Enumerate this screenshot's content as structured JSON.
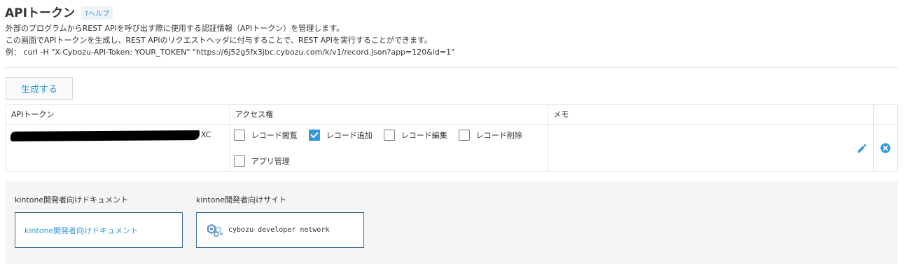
{
  "header": {
    "title": "APIトークン",
    "help_label": "?ヘルプ"
  },
  "description": {
    "line1": "外部のプログラムからREST APIを呼び出す際に使用する認証情報（APIトークン）を管理します。",
    "line2": "この画面でAPIトークンを生成し、REST APIのリクエストヘッダに付与することで、REST APIを実行することができます。",
    "line3": "例：  curl -H \"X-Cybozu-API-Token: YOUR_TOKEN\" \"https://6j52g5fx3jbc.cybozu.com/k/v1/record.json?app=120&id=1\""
  },
  "generate_button": "生成する",
  "table": {
    "headers": {
      "token": "APIトークン",
      "access": "アクセス権",
      "memo": "メモ"
    },
    "rows": [
      {
        "token_visible_tail": "XC",
        "permissions": [
          {
            "label": "レコード閲覧",
            "checked": false
          },
          {
            "label": "レコード追加",
            "checked": true
          },
          {
            "label": "レコード編集",
            "checked": false
          },
          {
            "label": "レコード削除",
            "checked": false
          },
          {
            "label": "アプリ管理",
            "checked": false
          }
        ],
        "memo": ""
      }
    ]
  },
  "footer": {
    "docs_title": "kintone開発者向けドキュメント",
    "docs_link": "kintone開発者向けドキュメント",
    "site_title": "kintone開発者向けサイト",
    "site_link": "cybozu developer network"
  },
  "colors": {
    "accent": "#3498db",
    "border": "#e3e7e8",
    "footer_bg": "#f5f5f5",
    "box_border": "#3a6e94"
  },
  "icons": {
    "edit": "pencil-icon",
    "delete": "close-circle-icon",
    "cdn_logo": "cybozu-developer-network-logo"
  }
}
